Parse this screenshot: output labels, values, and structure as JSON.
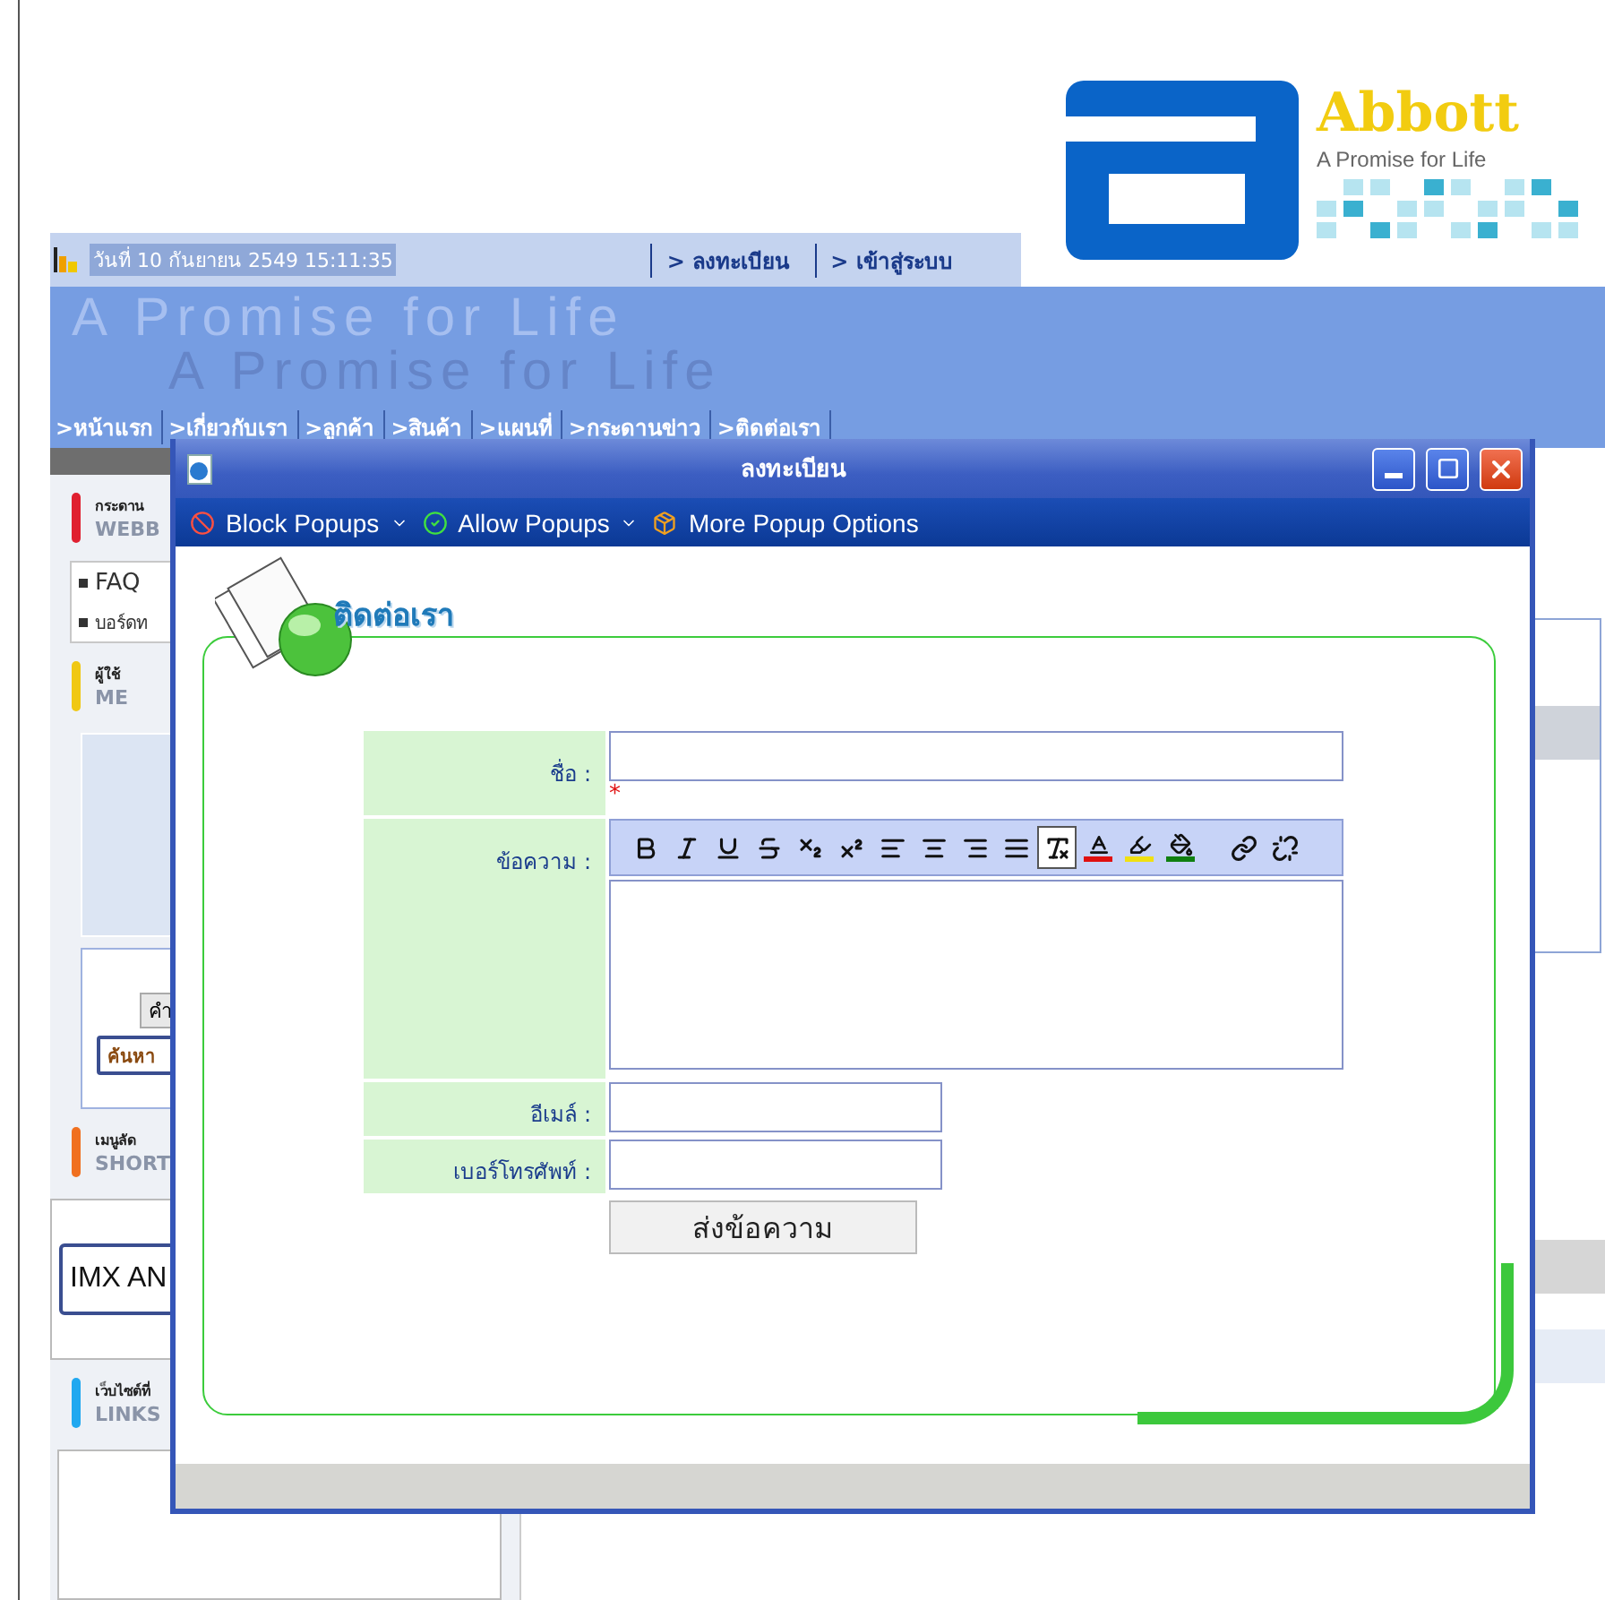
{
  "background_page": {
    "logo": {
      "brand": "Abbott",
      "tagline": "A Promise for Life"
    },
    "top_bar": {
      "datetime": "วันที่ 10 กันยายน 2549 15:11:35",
      "links": [
        "> ลงทะเบียน",
        "> เข้าสู่ระบบ"
      ]
    },
    "banner": {
      "slogans": [
        "A Promise for Life",
        "A Promise for Life"
      ]
    },
    "nav": [
      ">หน้าแรก",
      ">เกี่ยวกับเรา",
      ">ลูกค้า",
      ">สินค้า",
      ">แผนที่",
      ">กระดานข่าว",
      ">ติดต่อเรา"
    ],
    "sidebar": [
      {
        "kind": "header",
        "color": "#e02030",
        "title": "กระดาน",
        "subtitle": "WEBB"
      },
      {
        "kind": "list",
        "items": [
          "FAQ",
          "บอร์ดท"
        ]
      },
      {
        "kind": "header",
        "color": "#f0c814",
        "title": "ผู้ใช้",
        "subtitle": "ME"
      },
      {
        "kind": "panel"
      },
      {
        "kind": "search",
        "button": "คำ",
        "field": "ค้นหา"
      },
      {
        "kind": "header",
        "color": "#f07020",
        "title": "เมนูลัด",
        "subtitle": "SHORT"
      },
      {
        "kind": "select",
        "value": "IMX AN"
      },
      {
        "kind": "header",
        "color": "#20a8f0",
        "title": "เว็บไซต์ที่",
        "subtitle": "LINKS"
      },
      {
        "kind": "box"
      }
    ]
  },
  "popup": {
    "title": "ลงทะเบียน",
    "toolbar": [
      {
        "label": "Block Popups",
        "dropdown": true
      },
      {
        "label": "Allow Popups",
        "dropdown": true
      },
      {
        "label": "More Popup Options",
        "dropdown": false
      }
    ],
    "heading": "ติดต่อเรา",
    "form": {
      "fields": [
        {
          "kind": "long",
          "label": "ชื่อ :",
          "required_mark": "*"
        },
        {
          "kind": "editor",
          "label": "ข้อความ :"
        },
        {
          "kind": "short",
          "label": "อีเมล์ :"
        },
        {
          "kind": "short",
          "label": "เบอร์โทรศัพท์ :"
        }
      ],
      "editor_toolbar": [
        {
          "selected": false
        },
        {
          "selected": false
        },
        {
          "selected": false
        },
        {
          "selected": false
        },
        {
          "selected": false
        },
        {
          "selected": false
        },
        {
          "selected": false
        },
        {
          "selected": false
        },
        {
          "selected": false
        },
        {
          "selected": false
        },
        {
          "selected": true
        },
        {
          "selected": false
        },
        {
          "selected": false
        },
        {
          "selected": false
        },
        {
          "selected": false
        },
        {
          "selected": false
        }
      ],
      "submit": "ส่งข้อความ"
    }
  }
}
